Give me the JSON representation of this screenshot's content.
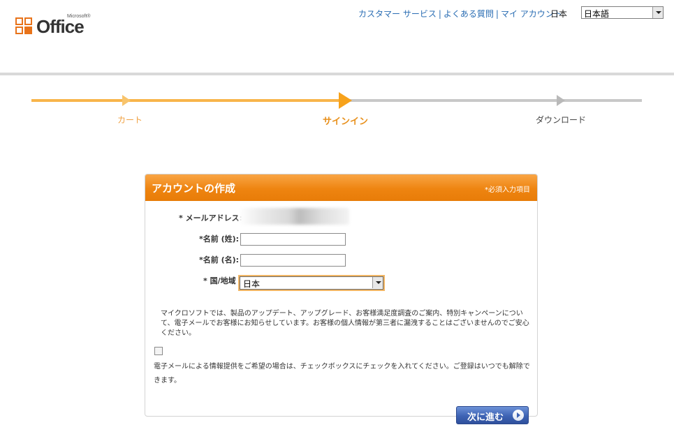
{
  "header": {
    "logo_brand": "Office",
    "logo_ms": "Microsoft®",
    "links": [
      "カスタマー サービス",
      "よくある質問",
      "マイ アカウント"
    ],
    "link_separator": "|",
    "country": "日本",
    "language_selected": "日本語"
  },
  "progress": {
    "steps": [
      "カート",
      "サインイン",
      "ダウンロード"
    ],
    "current_index": 1,
    "colors": {
      "done": "#f8b54a",
      "current": "#f7a21b",
      "todo": "#c8c8c8"
    }
  },
  "form": {
    "title": "アカウントの作成",
    "required_note": "*必須入力項目",
    "email_label": "* メールアドレス:",
    "last_name_label": "*名前 (姓):",
    "first_name_label": "*名前 (名):",
    "last_name_value": "",
    "first_name_value": "",
    "country_label": "* 国/地域",
    "country_selected": "日本",
    "notice": "マイクロソフトでは、製品のアップデート、アップグレード、お客様満足度調査のご案内、特別キャンペーンについて、電子メールでお客様にお知らせしています。お客様の個人情報が第三者に漏洩することはございませんのでご安心ください。",
    "optin_checked": false,
    "optin_text": "電子メールによる情報提供をご希望の場合は、チェックボックスにチェックを入れてください。ご登録はいつでも解除できます。",
    "next_button": "次に進む",
    "accent_color": "#ee8410",
    "button_color": "#3e63b4"
  }
}
